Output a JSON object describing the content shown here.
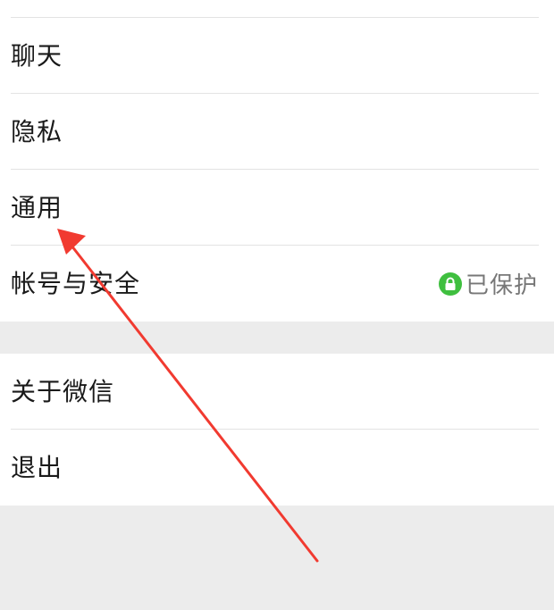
{
  "settings": {
    "items_top": [
      {
        "label": "聊天"
      },
      {
        "label": "隐私"
      },
      {
        "label": "通用"
      },
      {
        "label": "帐号与安全",
        "status": "已保护"
      }
    ],
    "items_bottom": [
      {
        "label": "关于微信"
      },
      {
        "label": "退出"
      }
    ]
  },
  "colors": {
    "protected_green": "#3fbf3f",
    "annotation_arrow": "#f13a30"
  },
  "icons": {
    "status": "lock-icon",
    "annotation": "arrow-annotation"
  }
}
